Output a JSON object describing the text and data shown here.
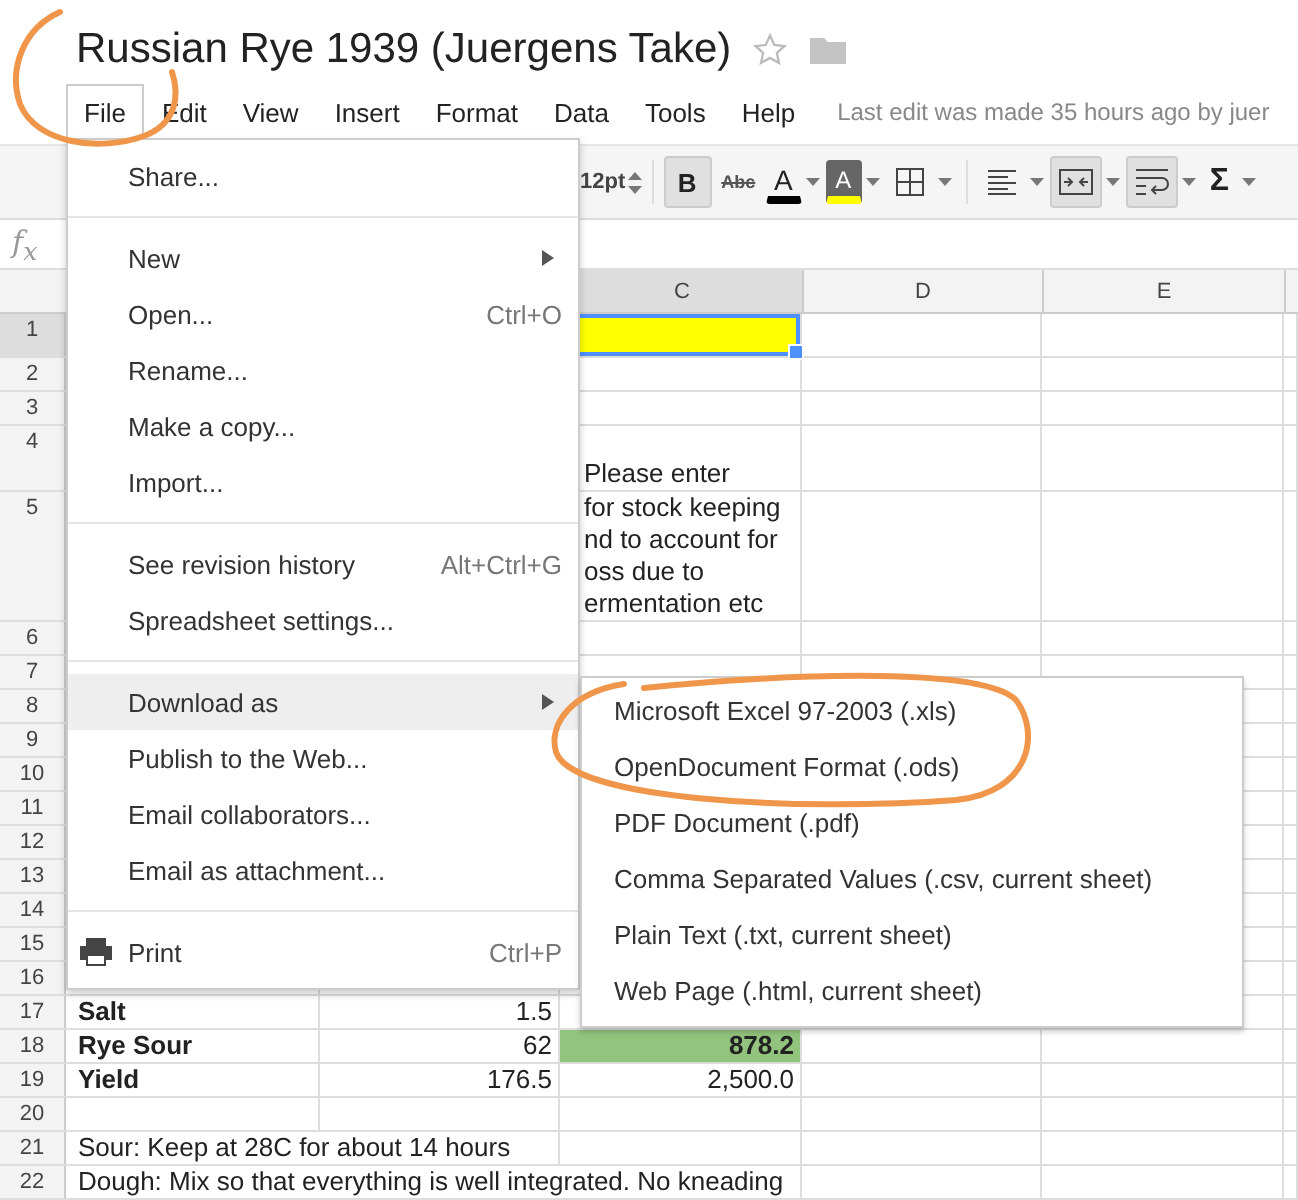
{
  "document": {
    "title": "Russian Rye 1939 (Juergens Take)",
    "starred": false
  },
  "menu_bar": [
    {
      "label": "File",
      "selected": true
    },
    {
      "label": "Edit",
      "selected": false
    },
    {
      "label": "View",
      "selected": false
    },
    {
      "label": "Insert",
      "selected": false
    },
    {
      "label": "Format",
      "selected": false
    },
    {
      "label": "Data",
      "selected": false
    },
    {
      "label": "Tools",
      "selected": false
    },
    {
      "label": "Help",
      "selected": false
    }
  ],
  "last_edit": "Last edit was made 35 hours ago by juer",
  "toolbar": {
    "font_size": "12pt",
    "buttons": [
      {
        "kind": "bold",
        "label": "B",
        "pressed": true
      },
      {
        "kind": "strike",
        "label": "Abc",
        "pressed": false
      },
      {
        "kind": "text-color",
        "label": "A",
        "pressed": false
      },
      {
        "kind": "highlight",
        "label": "A",
        "pressed": false
      },
      {
        "kind": "borders",
        "pressed": false
      },
      {
        "kind": "align",
        "pressed": false
      },
      {
        "kind": "merge",
        "pressed": true
      },
      {
        "kind": "wrap",
        "pressed": true
      },
      {
        "kind": "sum",
        "label": "Σ",
        "pressed": false
      }
    ]
  },
  "formula_bar": {
    "fx_label": "f$_{x}$"
  },
  "columns": [
    {
      "label": "C",
      "selected": true
    },
    {
      "label": "D",
      "selected": false
    },
    {
      "label": "E",
      "selected": false
    }
  ],
  "rows": [
    {
      "number": "1",
      "selected": true,
      "c": {
        "color": "#ffff00",
        "active": true
      }
    },
    {
      "number": "2",
      "selected": false
    },
    {
      "number": "3",
      "selected": false
    },
    {
      "number": "4",
      "selected": false,
      "c": {
        "text": "Please enter",
        "bold": false,
        "kind": "text"
      }
    },
    {
      "number": "5",
      "selected": false,
      "c": {
        "text": "for stock keeping\nnd to account for\noss due to\nermentation etc",
        "bold": false,
        "kind": "text"
      }
    },
    {
      "number": "6",
      "selected": false
    },
    {
      "number": "7",
      "selected": false
    },
    {
      "number": "8",
      "selected": false
    },
    {
      "number": "9",
      "selected": false
    },
    {
      "number": "10",
      "selected": false
    },
    {
      "number": "11",
      "selected": false
    },
    {
      "number": "12",
      "selected": false
    },
    {
      "number": "13",
      "selected": false
    },
    {
      "number": "14",
      "selected": false
    },
    {
      "number": "15",
      "selected": false
    },
    {
      "number": "16",
      "selected": false
    },
    {
      "number": "17",
      "selected": false,
      "a": {
        "text": "Salt",
        "bold": true
      },
      "b": {
        "text": "1.5",
        "bold": false
      }
    },
    {
      "number": "18",
      "selected": false,
      "a": {
        "text": "Rye Sour",
        "bold": true
      },
      "b": {
        "text": "62",
        "bold": false
      },
      "c": {
        "text": "878.2",
        "color": "#93c47d",
        "bold": true,
        "kind": "number"
      }
    },
    {
      "number": "19",
      "selected": false,
      "a": {
        "text": "Yield",
        "bold": true
      },
      "b": {
        "text": "176.5",
        "bold": false
      },
      "c": {
        "text": "2,500.0",
        "bold": false,
        "kind": "number"
      }
    },
    {
      "number": "20",
      "selected": false
    },
    {
      "number": "21",
      "selected": false,
      "a": {
        "text": "Sour: Keep at 28C for about 14 hours",
        "bold": false
      }
    },
    {
      "number": "22",
      "selected": false,
      "a": {
        "text": "Dough: Mix so that everything is well integrated. No kneading",
        "bold": false
      }
    }
  ],
  "file_menu": [
    {
      "kind": "item",
      "label": "Share...",
      "has_submenu": false,
      "highlighted": false
    },
    {
      "kind": "divider"
    },
    {
      "kind": "item",
      "label": "New",
      "has_submenu": true,
      "highlighted": false
    },
    {
      "kind": "item",
      "label": "Open...",
      "shortcut": "Ctrl+O",
      "has_submenu": false,
      "highlighted": false
    },
    {
      "kind": "item",
      "label": "Rename...",
      "has_submenu": false,
      "highlighted": false
    },
    {
      "kind": "item",
      "label": "Make a copy...",
      "has_submenu": false,
      "highlighted": false
    },
    {
      "kind": "item",
      "label": "Import...",
      "has_submenu": false,
      "highlighted": false
    },
    {
      "kind": "divider"
    },
    {
      "kind": "item",
      "label": "See revision history",
      "shortcut": "Alt+Ctrl+G",
      "has_submenu": false,
      "highlighted": false
    },
    {
      "kind": "item",
      "label": "Spreadsheet settings...",
      "has_submenu": false,
      "highlighted": false
    },
    {
      "kind": "divider"
    },
    {
      "kind": "item",
      "label": "Download as",
      "has_submenu": true,
      "highlighted": true
    },
    {
      "kind": "item",
      "label": "Publish to the Web...",
      "has_submenu": false,
      "highlighted": false
    },
    {
      "kind": "item",
      "label": "Email collaborators...",
      "has_submenu": false,
      "highlighted": false
    },
    {
      "kind": "item",
      "label": "Email as attachment...",
      "has_submenu": false,
      "highlighted": false
    },
    {
      "kind": "divider"
    },
    {
      "kind": "print",
      "label": "Print",
      "shortcut": "Ctrl+P",
      "has_submenu": false,
      "highlighted": false
    }
  ],
  "download_menu": [
    "Microsoft Excel 97-2003 (.xls)",
    "OpenDocument Format (.ods)",
    "PDF Document (.pdf)",
    "Comma Separated Values (.csv, current sheet)",
    "Plain Text (.txt, current sheet)",
    "Web Page (.html, current sheet)"
  ]
}
